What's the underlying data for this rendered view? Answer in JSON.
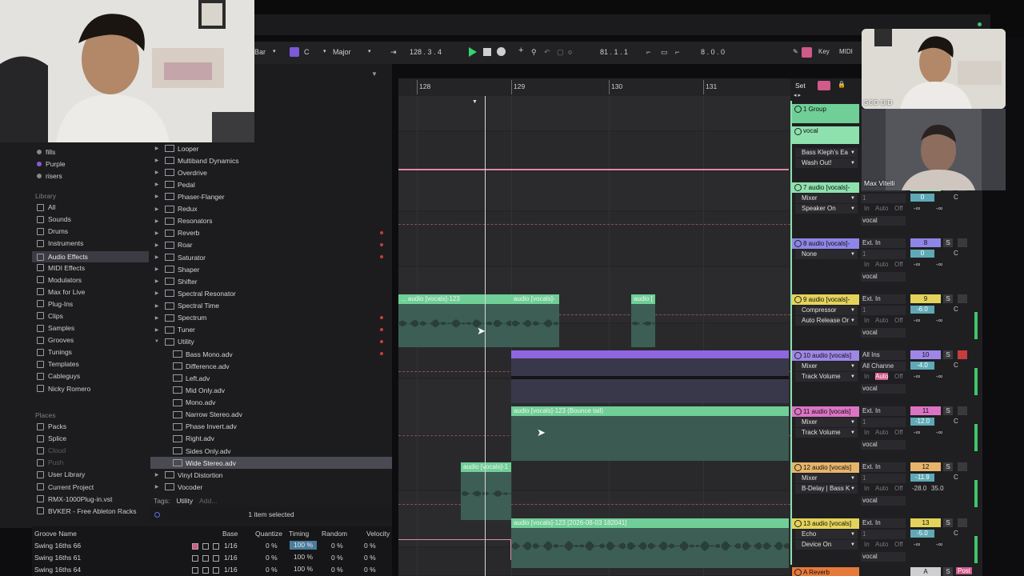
{
  "transport": {
    "grid": "Bar",
    "key_root": "C",
    "scale": "Major",
    "position": "128 .  3 .  4",
    "loop_start": "81 .  1 .  1",
    "loop_length": "8 .  0 .  0",
    "key_label": "Key",
    "midi_label": "MIDI"
  },
  "sidebar": {
    "collections": [
      {
        "label": "fills",
        "color": "#888888"
      },
      {
        "label": "Purple",
        "color": "#8a5ad6"
      },
      {
        "label": "risers",
        "color": "#888888"
      }
    ],
    "library_title": "Library",
    "library": [
      "All",
      "Sounds",
      "Drums",
      "Instruments",
      "Audio Effects",
      "MIDI Effects",
      "Modulators",
      "Max for Live",
      "Plug-Ins",
      "Clips",
      "Samples",
      "Grooves",
      "Tunings",
      "Templates",
      "Cableguys",
      "Nicky Romero"
    ],
    "selected": "Audio Effects",
    "places_title": "Places",
    "places": [
      "Packs",
      "Splice",
      "Cloud",
      "Push",
      "User Library",
      "Current Project",
      "RMX-1000Plug-in.vst",
      "BVKER - Free Ableton Racks"
    ]
  },
  "browser_list": [
    {
      "label": "Looper",
      "type": "folder",
      "mark": false
    },
    {
      "label": "Multiband Dynamics",
      "type": "folder",
      "mark": false
    },
    {
      "label": "Overdrive",
      "type": "folder",
      "mark": false
    },
    {
      "label": "Pedal",
      "type": "folder",
      "mark": false
    },
    {
      "label": "Phaser-Flanger",
      "type": "folder",
      "mark": false
    },
    {
      "label": "Redux",
      "type": "folder",
      "mark": false
    },
    {
      "label": "Resonators",
      "type": "folder",
      "mark": false
    },
    {
      "label": "Reverb",
      "type": "folder",
      "mark": true
    },
    {
      "label": "Roar",
      "type": "folder",
      "mark": true
    },
    {
      "label": "Saturator",
      "type": "folder",
      "mark": true
    },
    {
      "label": "Shaper",
      "type": "folder",
      "mark": false
    },
    {
      "label": "Shifter",
      "type": "folder",
      "mark": false
    },
    {
      "label": "Spectral Resonator",
      "type": "folder",
      "mark": false
    },
    {
      "label": "Spectral Time",
      "type": "folder",
      "mark": false
    },
    {
      "label": "Spectrum",
      "type": "folder",
      "mark": true
    },
    {
      "label": "Tuner",
      "type": "folder",
      "mark": true
    },
    {
      "label": "Utility",
      "type": "open-folder",
      "mark": true
    },
    {
      "label": "Bass Mono.adv",
      "type": "preset",
      "mark": true
    },
    {
      "label": "Difference.adv",
      "type": "preset",
      "mark": false
    },
    {
      "label": "Left.adv",
      "type": "preset",
      "mark": false
    },
    {
      "label": "Mid Only.adv",
      "type": "preset",
      "mark": false
    },
    {
      "label": "Mono.adv",
      "type": "preset",
      "mark": false
    },
    {
      "label": "Narrow Stereo.adv",
      "type": "preset",
      "mark": false
    },
    {
      "label": "Phase Invert.adv",
      "type": "preset",
      "mark": false
    },
    {
      "label": "Right.adv",
      "type": "preset",
      "mark": false
    },
    {
      "label": "Sides Only.adv",
      "type": "preset",
      "mark": false
    },
    {
      "label": "Wide Stereo.adv",
      "type": "preset-selected",
      "mark": false
    },
    {
      "label": "Vinyl Distortion",
      "type": "folder",
      "mark": false
    },
    {
      "label": "Vocoder",
      "type": "folder",
      "mark": false
    }
  ],
  "tags": {
    "label": "Tags:",
    "value": "Utility",
    "add": "Add..."
  },
  "selection_status": "1 item selected",
  "groove": {
    "headers": [
      "Groove Name",
      "Base",
      "Quantize",
      "Timing",
      "Random",
      "Velocity"
    ],
    "rows": [
      {
        "name": "Swing 16ths 66",
        "base": "1/16",
        "quantize": "0 %",
        "timing": "100 %",
        "random": "0 %",
        "velocity": "0 %"
      },
      {
        "name": "Swing 16ths 61",
        "base": "1/16",
        "quantize": "0 %",
        "timing": "100 %",
        "random": "0 %",
        "velocity": "0 %"
      },
      {
        "name": "Swing 16ths 64",
        "base": "1/16",
        "quantize": "0 %",
        "timing": "100 %",
        "random": "0 %",
        "velocity": "0 %"
      }
    ]
  },
  "ruler": [
    "128",
    "129",
    "130",
    "131"
  ],
  "clips": [
    {
      "title": "... audio [vocals]-123"
    },
    {
      "title": "audio [vocals]-"
    },
    {
      "title": "audio ["
    },
    {
      "title": "audio [vocals]-123 (Bounce tail)"
    },
    {
      "title": "audio [vocals]-1"
    },
    {
      "title": "audio [vocals]-123 [2026-08-03 182041]"
    }
  ],
  "mixer": {
    "set_label": "Set",
    "tracks": [
      {
        "name": "1 Group",
        "color": "#6fcf97"
      },
      {
        "name": "vocal",
        "color": "#8ee0ad"
      },
      {
        "name": "7 audio [vocals]-",
        "color": "#8ee0ad",
        "devices": [
          "Mixer",
          "Speaker On"
        ],
        "input": "1/2",
        "num": "",
        "vol": "0",
        "pan": "C",
        "out": "vocal"
      },
      {
        "name": "8 audio [vocals]-",
        "color": "#8e86e6",
        "devices": [
          "None"
        ],
        "input": "Ext. In",
        "num": "8",
        "vol": "0",
        "pan": "C",
        "out": "vocal"
      },
      {
        "name": "9 audio [vocals]-",
        "color": "#e4d35a",
        "devices": [
          "Compressor",
          "Auto Release Or"
        ],
        "input": "Ext. In",
        "num": "9",
        "vol": "-6.0",
        "pan": "C",
        "out": "vocal"
      },
      {
        "name": "10 audio [vocals]",
        "color": "#9e86e6",
        "devices": [
          "Mixer",
          "Track Volume"
        ],
        "input": "All Ins",
        "num": "10",
        "vol": "-4.0",
        "pan": "C",
        "out": "vocal",
        "input2": "All Channe"
      },
      {
        "name": "11 audio [vocals]",
        "color": "#dc74c4",
        "devices": [
          "Mixer",
          "Track Volume"
        ],
        "input": "Ext. In",
        "num": "11",
        "vol": "-12.0",
        "pan": "C",
        "out": "vocal"
      },
      {
        "name": "12 audio [vocals]",
        "color": "#e6b46a",
        "devices": [
          "Mixer",
          "B-Delay | Bass K"
        ],
        "input": "Ext. In",
        "num": "12",
        "vol": "-11.9",
        "pan": "C",
        "out": "vocal",
        "extra": [
          "-28.0",
          "35.0"
        ]
      },
      {
        "name": "13 audio [vocals]",
        "color": "#e4d35a",
        "devices": [
          "Echo",
          "Device On"
        ],
        "input": "Ext. In",
        "num": "13",
        "vol": "-5.0",
        "pan": "C",
        "out": "vocal"
      },
      {
        "name": "A Reverb",
        "color": "#e67a3a",
        "num": "A",
        "post": "Post"
      }
    ],
    "inserts_vocal": [
      "Bass Kleph's Ea",
      "Wash Out!"
    ],
    "inf_label": "-∞",
    "in_label": "In",
    "auto_label": "Auto",
    "off_label": "Off",
    "s_label": "S"
  },
  "webcams": [
    {
      "caption": "GOD DID"
    },
    {
      "caption": "Max Vitelli"
    }
  ],
  "colors": {
    "clip_green": "#6fcf97",
    "clip_green_dark": "#3d7a62",
    "clip_purple": "#8e66e0",
    "automation_pink": "#e08aa0",
    "accent_pink": "#d05a8a"
  }
}
